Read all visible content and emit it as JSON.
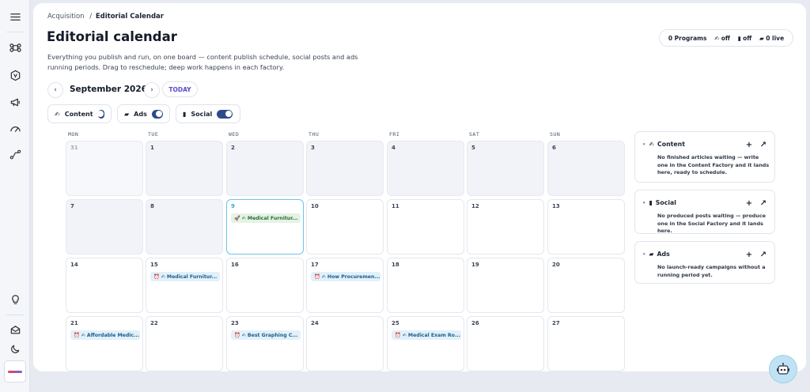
{
  "breadcrumb": {
    "parent": "Acquisition",
    "separator": "/",
    "current": "Editorial Calendar"
  },
  "header": {
    "title": "Editorial calendar",
    "description": "Everything you publish and run, on one board — content publish schedule, social posts and ads running periods. Drag to reschedule; deep work happens in each factory."
  },
  "stats": {
    "programs": "0 Programs",
    "content": "off",
    "social": "off",
    "ads": "0 live"
  },
  "calendar": {
    "month_label": "September 2026",
    "prev_icon": "‹",
    "next_icon": "›",
    "today_label": "TODAY",
    "weekdays": [
      "MON",
      "TUE",
      "WED",
      "THU",
      "FRI",
      "SAT",
      "SUN"
    ],
    "days": {
      "d31": "31",
      "d1": "1",
      "d2": "2",
      "d3": "3",
      "d4": "4",
      "d5": "5",
      "d6": "6",
      "d7": "7",
      "d8": "8",
      "d9": "9",
      "d10": "10",
      "d11": "11",
      "d12": "12",
      "d13": "13",
      "d14": "14",
      "d15": "15",
      "d16": "16",
      "d17": "17",
      "d18": "18",
      "d19": "19",
      "d20": "20",
      "d21": "21",
      "d22": "22",
      "d23": "23",
      "d24": "24",
      "d25": "25",
      "d26": "26",
      "d27": "27"
    },
    "events": {
      "e9": "Medical Furnitur...",
      "e15": "Medical Furnitur...",
      "e17": "How Procuremen...",
      "e21": "Affordable Medic...",
      "e23": "Best Graphing C...",
      "e25": "Medical Exam Ro..."
    }
  },
  "filters": {
    "content": "Content",
    "ads": "Ads",
    "social": "Social"
  },
  "sidepanels": {
    "content": {
      "title": "Content",
      "text": "No finished articles waiting — write one in the Content Factory and it lands here, ready to schedule."
    },
    "social": {
      "title": "Social",
      "text": "No produced posts waiting — produce one in the Social Factory and it lands here."
    },
    "ads": {
      "title": "Ads",
      "text": "No launch-ready campaigns without a running period yet."
    }
  },
  "colors": {
    "accent": "#5a4bc9",
    "toggle_on": "#2f4a8a",
    "today_border": "#6cc2e8",
    "scheduled_chip": "#e1f1fb",
    "live_chip": "#e4f3e6"
  }
}
